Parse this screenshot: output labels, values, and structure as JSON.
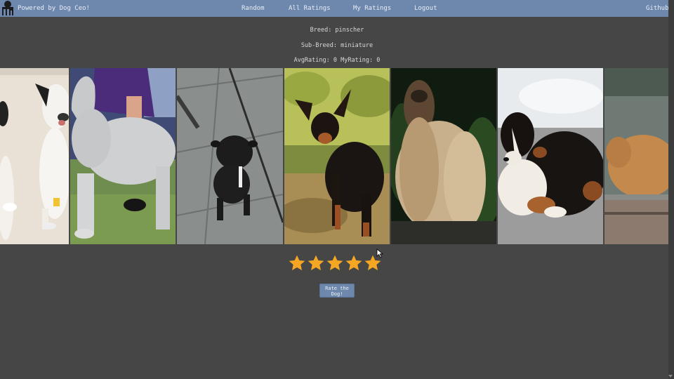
{
  "navbar": {
    "logo": "dog-logo-icon",
    "powered_by": "Powered by Dog Ceo!",
    "links": {
      "random": "Random",
      "all_ratings": "All Ratings",
      "my_ratings": "My Ratings",
      "logout": "Logout",
      "github": "Github"
    }
  },
  "dog": {
    "breed_line": "Breed: pinscher",
    "sub_breed_line": "Sub-Breed: miniature",
    "ratings_line": "AvgRating: 0 MyRating: 0"
  },
  "gallery": {
    "photos": [
      "border-collie-photo",
      "bedlington-terrier-photo",
      "black-puppy-photo",
      "miniature-pinscher-photo",
      "afghan-hound-photo",
      "bernese-mountain-dog-photo",
      "tan-dog-photo"
    ]
  },
  "rating": {
    "stars": 5,
    "icon": "star-icon",
    "star_color": "#f5a623"
  },
  "rate_button": {
    "label": "Rate the Dog!"
  },
  "colors": {
    "navbar": "#6d87ad",
    "background": "#464646",
    "button": "#6d87ad"
  }
}
